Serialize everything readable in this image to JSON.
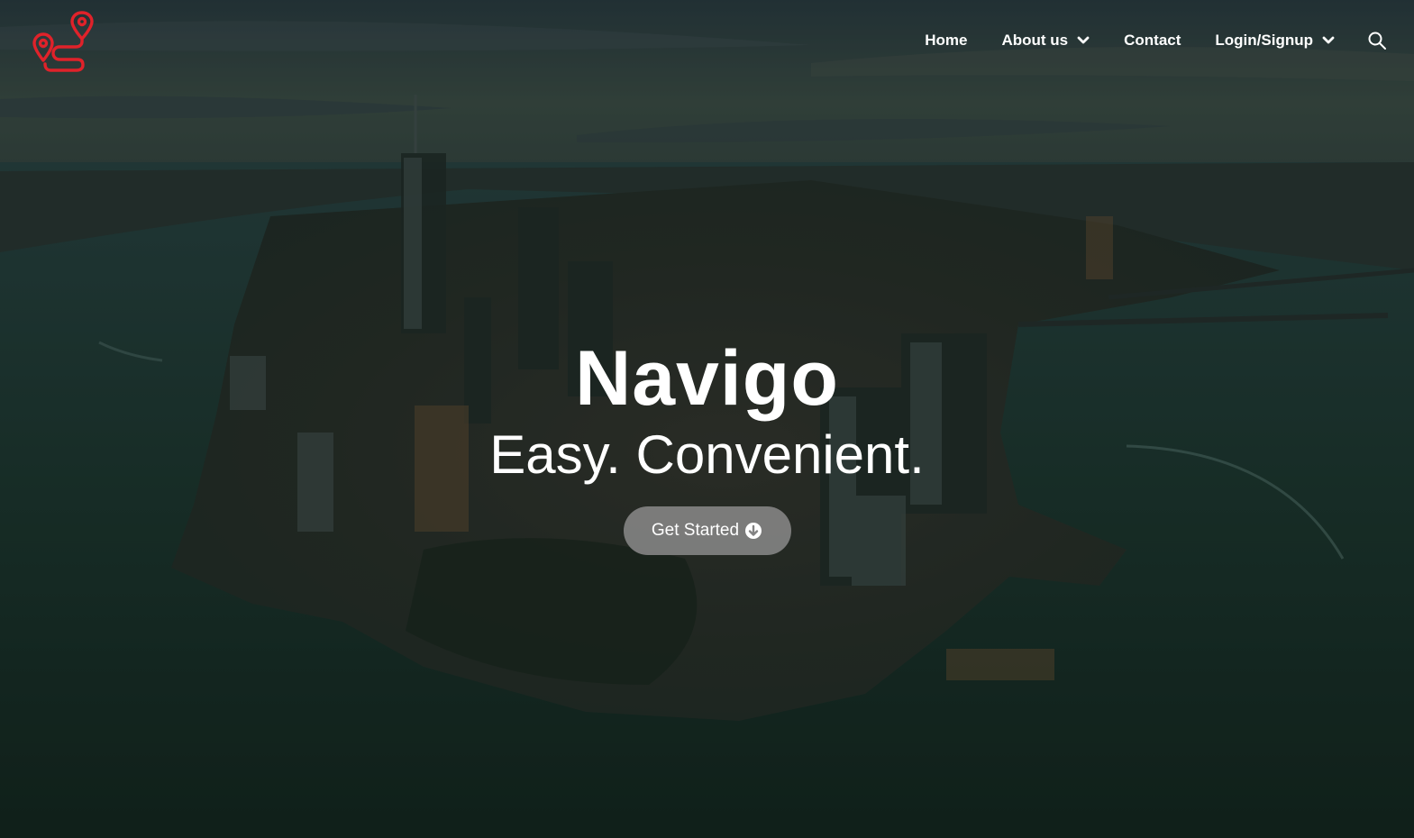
{
  "brand": {
    "logo_icon": "route-pin-icon",
    "logo_color": "#e0222a"
  },
  "nav": {
    "items": [
      {
        "label": "Home",
        "has_dropdown": false
      },
      {
        "label": "About us",
        "has_dropdown": true
      },
      {
        "label": "Contact",
        "has_dropdown": false
      },
      {
        "label": "Login/Signup",
        "has_dropdown": true
      }
    ],
    "search_icon": "search-icon"
  },
  "hero": {
    "title": "Navigo",
    "subtitle": "Easy. Convenient.",
    "cta_label": "Get Started",
    "cta_icon": "arrow-down-circle-icon",
    "cta_color": "#828282"
  },
  "colors": {
    "text": "#ffffff",
    "sky_top": "#2c3f48",
    "water": "#1d3a33"
  }
}
